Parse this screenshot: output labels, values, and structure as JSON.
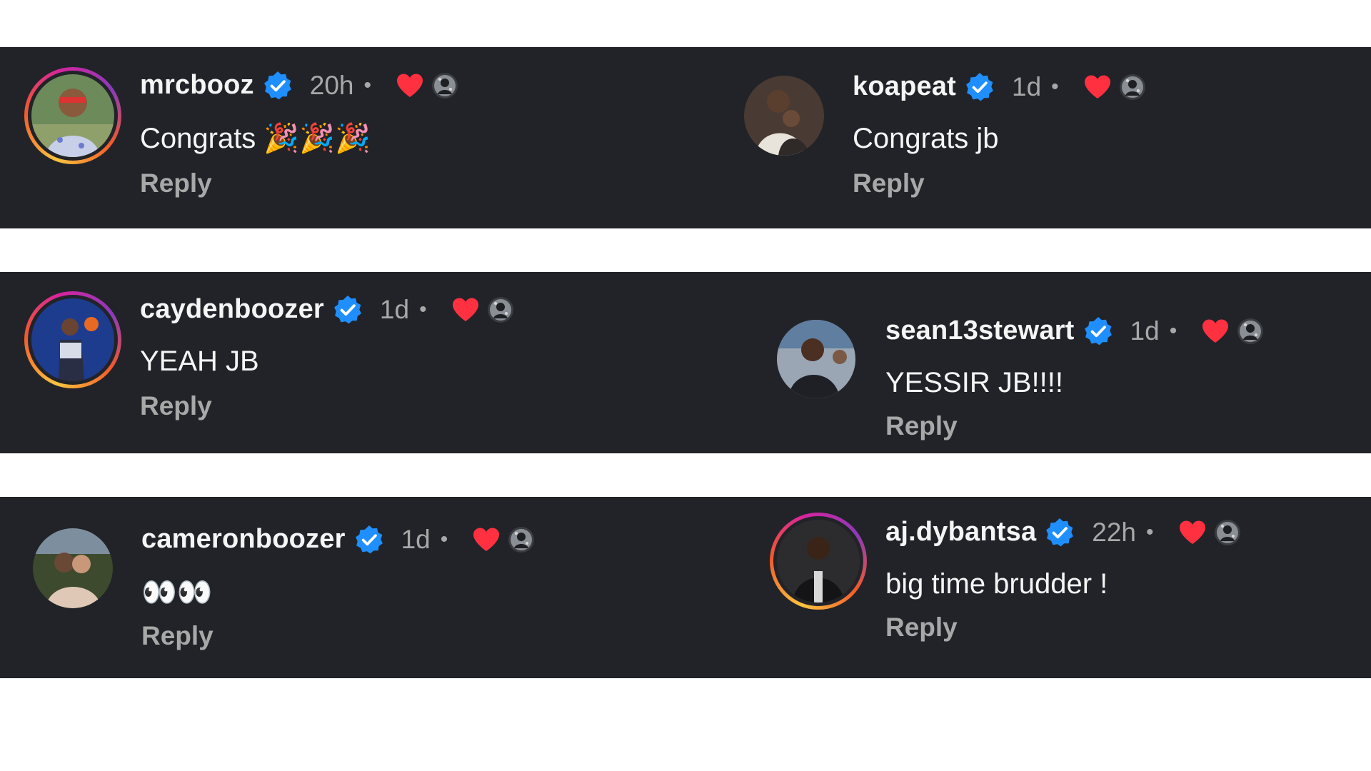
{
  "comments": [
    {
      "username": "mrcbooz",
      "time": "20h",
      "dot": "•",
      "text": "Congrats 🎉🎉🎉",
      "reply": "Reply",
      "verified_icon": "verified-badge-icon",
      "liked_icon": "heart-icon"
    },
    {
      "username": "koapeat",
      "time": "1d",
      "dot": "•",
      "text": "Congrats jb",
      "reply": "Reply",
      "verified_icon": "verified-badge-icon",
      "liked_icon": "heart-icon"
    },
    {
      "username": "caydenboozer",
      "time": "1d",
      "dot": "•",
      "text": "YEAH JB",
      "reply": "Reply",
      "verified_icon": "verified-badge-icon",
      "liked_icon": "heart-icon"
    },
    {
      "username": "sean13stewart",
      "time": "1d",
      "dot": "•",
      "text": "YESSIR JB!!!!",
      "reply": "Reply",
      "verified_icon": "verified-badge-icon",
      "liked_icon": "heart-icon"
    },
    {
      "username": "cameronboozer",
      "time": "1d",
      "dot": "•",
      "text": "👀👀",
      "reply": "Reply",
      "verified_icon": "verified-badge-icon",
      "liked_icon": "heart-icon"
    },
    {
      "username": "aj.dybantsa",
      "time": "22h",
      "dot": "•",
      "text": "big time brudder !",
      "reply": "Reply",
      "verified_icon": "verified-badge-icon",
      "liked_icon": "heart-icon"
    }
  ],
  "colors": {
    "background": "#212328",
    "text": "#f5f5f5",
    "muted": "#a8a8a8",
    "verified": "#1f8fff",
    "heart": "#ff3040"
  }
}
